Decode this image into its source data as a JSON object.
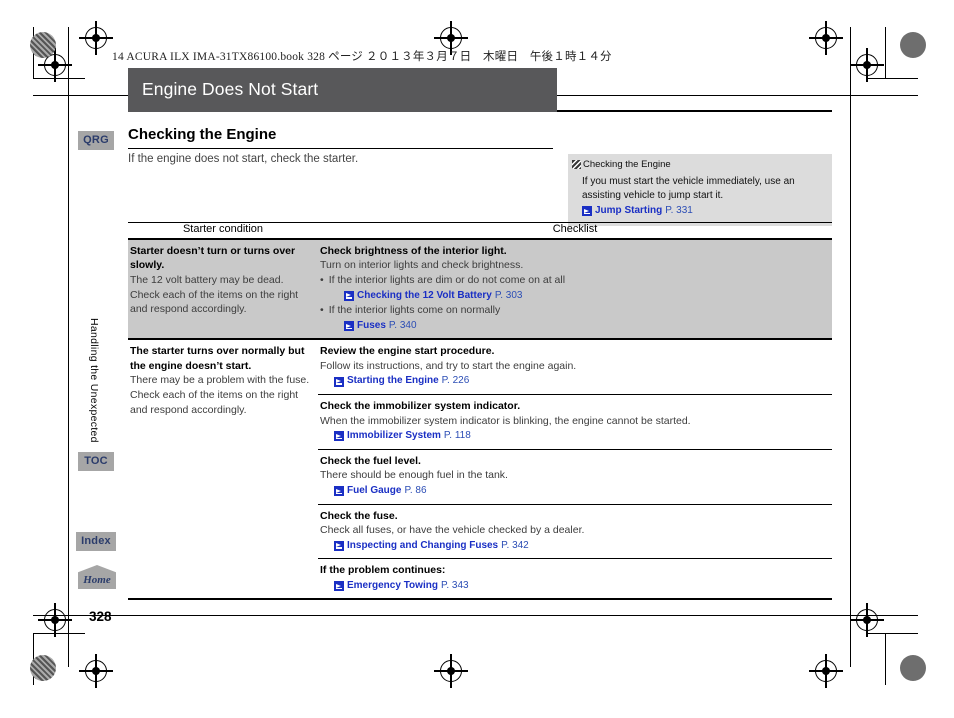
{
  "book_header": "14 ACURA ILX IMA-31TX86100.book  328 ページ  ２０１３年３月７日　木曜日　午後１時１４分",
  "section": {
    "title": "Engine Does Not Start",
    "subtitle": "Checking the Engine",
    "intro": "If the engine does not start, check the starter."
  },
  "rail": {
    "qrg": "QRG",
    "toc": "TOC",
    "index": "Index",
    "home": "Home",
    "chapter": "Handling the Unexpected",
    "page_number": "328"
  },
  "note": {
    "heading": "Checking the Engine",
    "body": "If you must start the vehicle immediately, use an assisting vehicle to jump start it.",
    "xref": {
      "label": "Jump Starting",
      "page": "P. 331"
    }
  },
  "table": {
    "headers": {
      "left": "Starter condition",
      "right": "Checklist"
    },
    "rows": [
      {
        "shaded": true,
        "condition": {
          "title": "Starter doesn’t turn or turns over slowly.",
          "desc": "The 12 volt battery may be dead. Check each of the items on the right and respond accordingly."
        },
        "checklist": [
          {
            "title": "Check brightness of the interior light.",
            "desc": "Turn on interior lights and check brightness.",
            "bullets": [
              {
                "text": "If the interior lights are dim or do not come on at all",
                "xref": {
                  "label": "Checking the 12 Volt Battery",
                  "page": "P. 303"
                }
              },
              {
                "text": "If the interior lights come on normally",
                "xref": {
                  "label": "Fuses",
                  "page": "P. 340"
                }
              }
            ]
          }
        ]
      },
      {
        "shaded": false,
        "condition": {
          "title": "The starter turns over normally but the engine doesn’t start.",
          "desc": "There may be a problem with the fuse. Check each of the items on the right and respond accordingly."
        },
        "checklist": [
          {
            "title": "Review the engine start procedure.",
            "desc": "Follow its instructions, and try to start the engine again.",
            "xref": {
              "label": "Starting the Engine",
              "page": "P. 226"
            }
          },
          {
            "title": "Check the immobilizer system indicator.",
            "desc": "When the immobilizer system indicator is blinking, the engine cannot be started.",
            "xref": {
              "label": "Immobilizer System",
              "page": "P. 118"
            }
          },
          {
            "title": "Check the fuel level.",
            "desc": "There should be enough fuel in the tank.",
            "xref": {
              "label": "Fuel Gauge",
              "page": "P. 86"
            }
          },
          {
            "title": "Check the fuse.",
            "desc": "Check all fuses, or have the vehicle checked by a dealer.",
            "xref": {
              "label": "Inspecting and Changing Fuses",
              "page": "P. 342"
            }
          },
          {
            "title": "If the problem continues:",
            "desc": "",
            "xref": {
              "label": "Emergency Towing",
              "page": "P. 343"
            }
          }
        ]
      }
    ]
  }
}
